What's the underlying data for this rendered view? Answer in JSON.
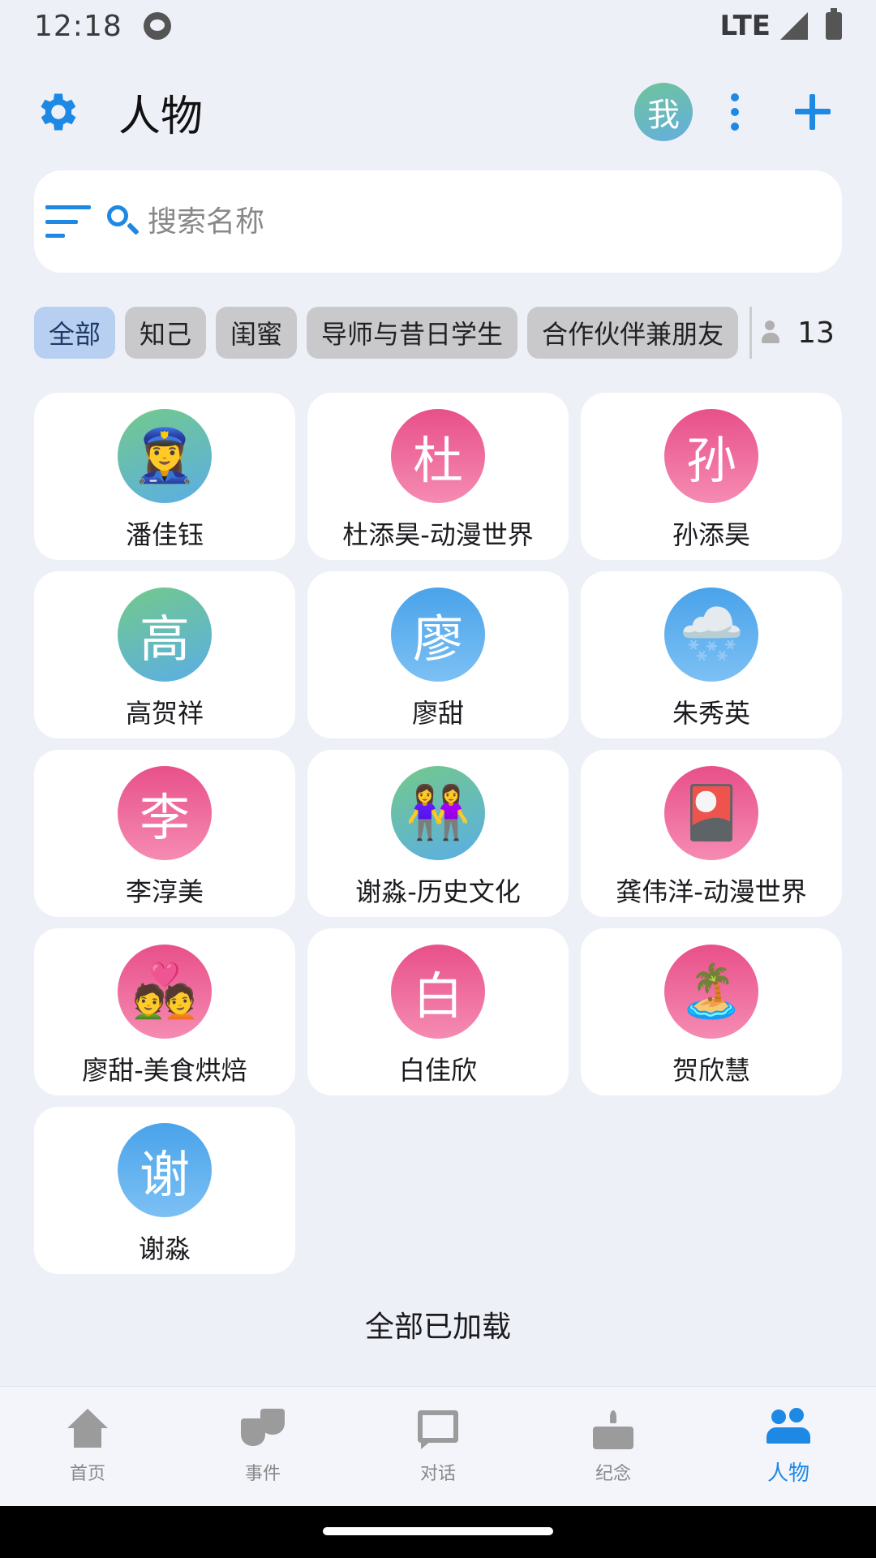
{
  "status_bar": {
    "time": "12:18",
    "network": "LTE"
  },
  "header": {
    "title": "人物",
    "me_avatar_label": "我"
  },
  "search": {
    "placeholder": "搜索名称",
    "value": ""
  },
  "chips": [
    {
      "label": "全部",
      "active": true
    },
    {
      "label": "知己",
      "active": false
    },
    {
      "label": "闺蜜",
      "active": false
    },
    {
      "label": "导师与昔日学生",
      "active": false
    },
    {
      "label": "合作伙伴兼朋友",
      "active": false
    }
  ],
  "person_count": "13",
  "people": [
    {
      "name": "潘佳钰",
      "avatar": "👮‍♀️",
      "style": "green"
    },
    {
      "name": "杜添昊-动漫世界",
      "avatar": "杜",
      "style": "pink"
    },
    {
      "name": "孙添昊",
      "avatar": "孙",
      "style": "pink"
    },
    {
      "name": "高贺祥",
      "avatar": "高",
      "style": "green"
    },
    {
      "name": "廖甜",
      "avatar": "廖",
      "style": "blue"
    },
    {
      "name": "朱秀英",
      "avatar": "🌨️",
      "style": "blue"
    },
    {
      "name": "李淳美",
      "avatar": "李",
      "style": "pink"
    },
    {
      "name": "谢淼-历史文化",
      "avatar": "👭",
      "style": "green"
    },
    {
      "name": "龚伟洋-动漫世界",
      "avatar": "🎴",
      "style": "pink"
    },
    {
      "name": "廖甜-美食烘焙",
      "avatar": "💑",
      "style": "pink"
    },
    {
      "name": "白佳欣",
      "avatar": "白",
      "style": "pink"
    },
    {
      "name": "贺欣慧",
      "avatar": "🏝️",
      "style": "pink"
    },
    {
      "name": "谢淼",
      "avatar": "谢",
      "style": "blue"
    }
  ],
  "footer_text": "全部已加载",
  "bottom_nav": [
    {
      "label": "首页",
      "icon": "home-icon",
      "active": false
    },
    {
      "label": "事件",
      "icon": "event-icon",
      "active": false
    },
    {
      "label": "对话",
      "icon": "chat-icon",
      "active": false
    },
    {
      "label": "纪念",
      "icon": "cake-icon",
      "active": false
    },
    {
      "label": "人物",
      "icon": "people-icon",
      "active": true
    }
  ],
  "colors": {
    "accent": "#1e88e5",
    "background": "#eef0f8",
    "chip_active": "#b7cff0",
    "chip": "#c9c9cc"
  }
}
